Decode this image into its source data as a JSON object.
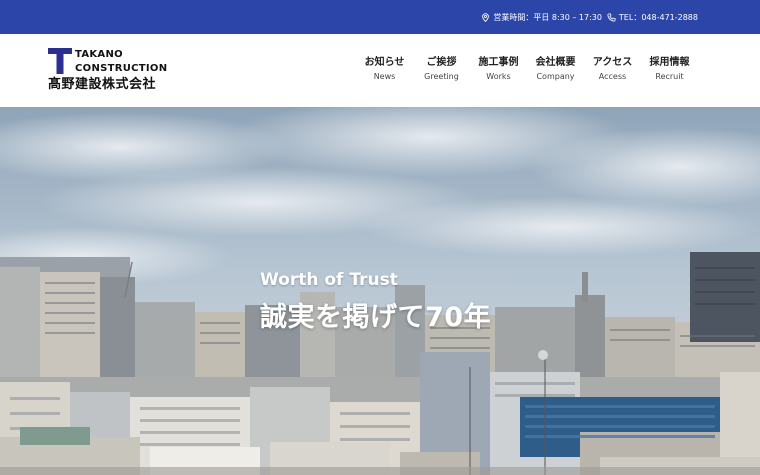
{
  "topbar": {
    "hours": "営業時間：平日 8:30 – 17:30",
    "tel": "TEL：048-471-2888",
    "pin_icon": "map-pin-icon",
    "phone_icon": "phone-icon"
  },
  "logo": {
    "en_line1": "TAKANO",
    "en_line2": "CONSTRUCTION",
    "jp": "髙野建設株式会社",
    "mark_color": "#2b2f8f"
  },
  "nav": {
    "items": [
      {
        "jp": "お知らせ",
        "en": "News"
      },
      {
        "jp": "ご挨拶",
        "en": "Greeting"
      },
      {
        "jp": "施工事例",
        "en": "Works"
      },
      {
        "jp": "会社概要",
        "en": "Company"
      },
      {
        "jp": "アクセス",
        "en": "Access"
      },
      {
        "jp": "採用情報",
        "en": "Recruit"
      }
    ]
  },
  "hero": {
    "subtitle": "Worth of Trust",
    "title": "誠実を掲げて70年"
  },
  "colors": {
    "topbar": "#2b46a8",
    "text": "#222222"
  }
}
